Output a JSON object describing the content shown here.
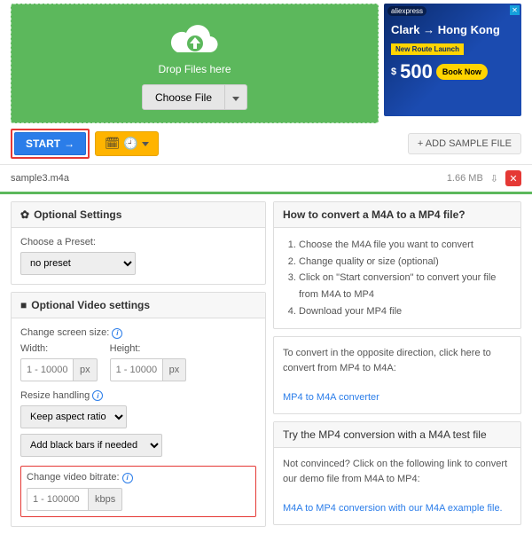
{
  "dropzone": {
    "text": "Drop Files here",
    "choose": "Choose File"
  },
  "ad": {
    "brand": "aliexpress",
    "dest": "Clark → Hong Kong",
    "route": "New Route Launch",
    "price": "500",
    "book": "Book Now"
  },
  "actions": {
    "start": "START",
    "add_sample": "+ ADD SAMPLE FILE"
  },
  "file": {
    "name": "sample3.m4a",
    "size": "1.66 MB"
  },
  "optional": {
    "title": "Optional Settings",
    "preset_label": "Choose a Preset:",
    "preset_value": "no preset"
  },
  "video": {
    "title": "Optional Video settings",
    "screen_label": "Change screen size:",
    "width_label": "Width:",
    "height_label": "Height:",
    "dim_placeholder": "1 - 10000",
    "px": "px",
    "resize_label": "Resize handling",
    "resize_value": "Keep aspect ratio",
    "bars_value": "Add black bars if needed",
    "bitrate_label": "Change video bitrate:",
    "bitrate_placeholder": "1 - 100000",
    "kbps": "kbps"
  },
  "howto": {
    "title": "How to convert a M4A to a MP4 file?",
    "steps": [
      "Choose the M4A file you want to convert",
      "Change quality or size (optional)",
      "Click on \"Start conversion\" to convert your file from M4A to MP4",
      "Download your MP4 file"
    ]
  },
  "reverse": {
    "text": "To convert in the opposite direction, click here to convert from MP4 to M4A:",
    "link": "MP4 to M4A converter"
  },
  "demo": {
    "try": "Try the MP4 conversion with a M4A test file",
    "text": "Not convinced? Click on the following link to convert our demo file from M4A to MP4:",
    "link": "M4A to MP4 conversion with our M4A example file."
  }
}
